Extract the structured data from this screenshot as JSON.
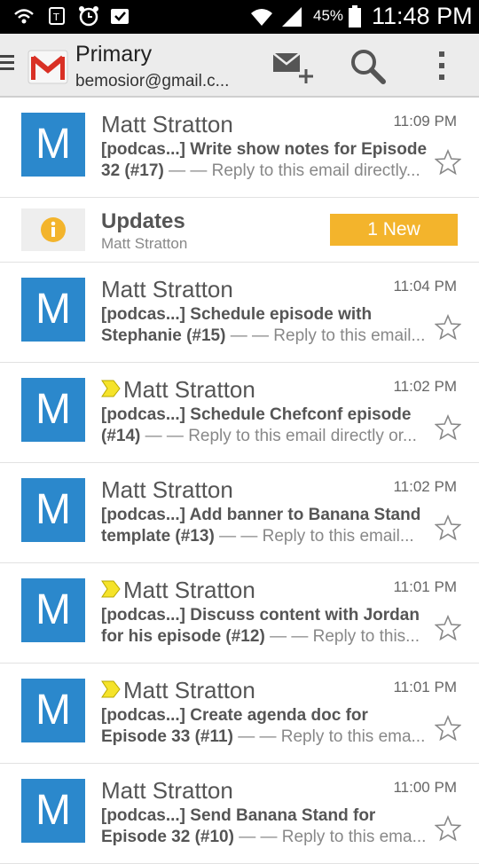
{
  "status_bar": {
    "battery": "45%",
    "time": "11:48 PM"
  },
  "header": {
    "title": "Primary",
    "account": "bemosior@gmail.c..."
  },
  "updates": {
    "title": "Updates",
    "sender": "Matt Stratton",
    "badge": "1 New"
  },
  "emails": [
    {
      "avatar": "M",
      "sender": "Matt Stratton",
      "time": "11:09 PM",
      "important": false,
      "subject_line1": "[podcas...] Write show notes for Episode",
      "subject_line2": "32 (#17)",
      "snippet": "— — Reply to this email directly..."
    },
    {
      "avatar": "M",
      "sender": "Matt Stratton",
      "time": "11:04 PM",
      "important": false,
      "subject_line1": "[podcas...] Schedule episode with",
      "subject_line2": "Stephanie (#15)",
      "snippet": "— — Reply to this email..."
    },
    {
      "avatar": "M",
      "sender": "Matt Stratton",
      "time": "11:02 PM",
      "important": true,
      "subject_line1": "[podcas...] Schedule Chefconf episode",
      "subject_line2": "(#14)",
      "snippet": "— — Reply to this email directly or..."
    },
    {
      "avatar": "M",
      "sender": "Matt Stratton",
      "time": "11:02 PM",
      "important": false,
      "subject_line1": "[podcas...] Add banner to Banana Stand",
      "subject_line2": "template (#13)",
      "snippet": "— — Reply to this email..."
    },
    {
      "avatar": "M",
      "sender": "Matt Stratton",
      "time": "11:01 PM",
      "important": true,
      "subject_line1": "[podcas...] Discuss content with Jordan",
      "subject_line2": "for his episode (#12)",
      "snippet": "— — Reply to this..."
    },
    {
      "avatar": "M",
      "sender": "Matt Stratton",
      "time": "11:01 PM",
      "important": true,
      "subject_line1": "[podcas...] Create agenda doc for",
      "subject_line2": "Episode 33 (#11)",
      "snippet": "— — Reply to this ema..."
    },
    {
      "avatar": "M",
      "sender": "Matt Stratton",
      "time": "11:00 PM",
      "important": false,
      "subject_line1": "[podcas...] Send Banana Stand for",
      "subject_line2": "Episode 32 (#10)",
      "snippet": "— — Reply to this ema..."
    }
  ],
  "colors": {
    "avatar": "#2b88cc",
    "badge": "#f3b42c",
    "important_marker": "#f5e32a",
    "info_icon": "#f3b42c"
  },
  "icons": {
    "compose": "compose-icon",
    "search": "search-icon",
    "overflow": "overflow-menu-icon",
    "star": "star-icon",
    "info": "info-icon"
  }
}
